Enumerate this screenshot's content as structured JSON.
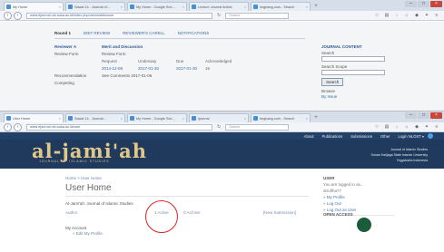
{
  "colors": {
    "tab_bar": "#d6dfe9",
    "banner": "#1f3a5c",
    "logo": "#e2c78a",
    "link": "#3a6aa8",
    "annotation_circle": "#d22",
    "close_button": "#c9463d"
  },
  "window1": {
    "tabs": [
      {
        "label": "My Home"
      },
      {
        "label": "Sawal 14 - Journal of..."
      },
      {
        "label": "My Home - Google Sch..."
      },
      {
        "label": "Lecture Journal Article"
      },
      {
        "label": "Imgbang.com - Search"
      }
    ],
    "url": "www.ejournal.uin-suka.ac.id/index.php/ushuluddin/user",
    "search_placeholder": "Search",
    "content": {
      "tabs": [
        "Round 1",
        "EDIT REVIEW",
        "REVIEWER'S CARELL",
        "NOTIFICATIONS"
      ],
      "section_label": "Reviewer A",
      "section_value": "Merit and Discussion",
      "review_form_key": "Review Form",
      "review_form_value": "Review Form",
      "grid": [
        [
          "Request",
          "Underway",
          "Due",
          "Acknowledged"
        ],
        [
          "2014-12-08",
          "2017-01-30",
          "2017-01-30",
          "16"
        ]
      ],
      "recommendation_key": "Recommendation",
      "recommendation_value": "See Comments  2017-01-06",
      "extra_row": "Competing"
    },
    "sidebar": {
      "header": "JOURNAL CONTENT",
      "search_label": "Search",
      "search_scope_label": "Search Scope",
      "search_button": "Search",
      "browse_label": "Browse",
      "browse_link": "By Issue"
    }
  },
  "window2": {
    "tabs": [
      {
        "label": "User Home"
      },
      {
        "label": "Sawal 14 - Journal..."
      },
      {
        "label": "My Home - Google Sch..."
      },
      {
        "label": "Ijournal"
      },
      {
        "label": "Imgbang.com - Search"
      }
    ],
    "url": "www.ejournal.uin-suka.ac.id/user",
    "search_placeholder": "Search",
    "banner": {
      "nav": [
        "About",
        "Publications",
        "Submissions",
        "Other"
      ],
      "user": "Login NLOST ▾",
      "logo": "al-jami'ah",
      "logo_sub": "JOURNAL OF ISLAMIC STUDIES",
      "right_lines": [
        "Journal of Islamic Studies",
        "Sunan Kalijaga State Islamic University",
        "Yogyakarta Indonesia"
      ]
    },
    "page": {
      "breadcrumb": "Home > User Home",
      "title": "User Home",
      "journal_name": "Al-Jami'ah: Journal of Islamic Studies",
      "stats": [
        {
          "label": "Author"
        },
        {
          "label": "1 Active"
        },
        {
          "label": "0 Archive"
        },
        {
          "label": "[New Submission]"
        }
      ],
      "account_header": "My Account",
      "account_link": "» Edit My Profile"
    },
    "sidebar": {
      "user_header": "USER",
      "user_text_1": "You are logged in as...",
      "user_text_2": "dr/ulfha77",
      "links": [
        "» My Profile",
        "» Log Out",
        "» Log Out as User"
      ],
      "open_access": "OPEN ACCESS"
    }
  }
}
